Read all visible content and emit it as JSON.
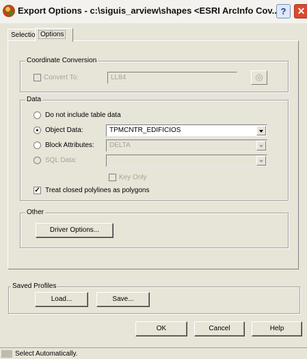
{
  "window": {
    "title": "Export Options - c:\\siguis_arview\\shapes <ESRI ArcInfo Cov...",
    "help_label": "?",
    "close_label": "✕"
  },
  "tabs": {
    "selection": "Selection",
    "options": "Options"
  },
  "coordinate_conversion": {
    "group_label": "Coordinate Conversion",
    "convert_to_label": "Convert To:",
    "convert_to_value": "LL84"
  },
  "data": {
    "group_label": "Data",
    "no_table_label": "Do not include table data",
    "object_data_label": "Object Data:",
    "object_data_value": "TPMCNTR_EDIFICIOS",
    "block_attributes_label": "Block Attributes:",
    "block_attributes_value": "DELTA",
    "sql_data_label": "SQL Data:",
    "sql_data_value": "",
    "key_only_label": "Key Only",
    "treat_polylines_label": "Treat closed polylines as polygons"
  },
  "other": {
    "group_label": "Other",
    "driver_options_label": "Driver Options..."
  },
  "saved_profiles": {
    "group_label": "Saved Profiles",
    "load_label": "Load...",
    "save_label": "Save..."
  },
  "buttons": {
    "ok": "OK",
    "cancel": "Cancel",
    "help": "Help"
  },
  "status": {
    "text": "Select Automatically."
  },
  "icons": {
    "app": "app-icon",
    "globe": "globe-icon"
  }
}
